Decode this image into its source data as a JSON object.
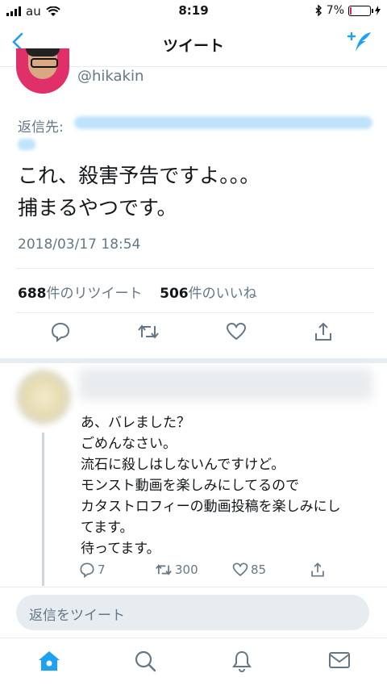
{
  "status_bar": {
    "carrier": "au",
    "time": "8:19",
    "battery": "7%"
  },
  "nav": {
    "title": "ツイート",
    "back_icon": "chevron-left-icon",
    "compose_icon": "compose-icon"
  },
  "tweet": {
    "handle": "@hikakin",
    "reply_prefix": "返信先:",
    "text": "これ、殺害予告ですよ。。。\n捕まるやつです。",
    "timestamp": "2018/03/17 18:54",
    "retweet_count": "688",
    "retweet_label": "件のリツイート",
    "like_count": "506",
    "like_label": "件のいいね"
  },
  "reply": {
    "text": "あ、バレました？\nごめんなさい。\n流石に殺しはしないんですけど。\nモンスト動画を楽しみにしてるので\nカタストロフィーの動画投稿を楽しみにし\nてます。\n待ってます。",
    "reply_count": "7",
    "retweet_count": "300",
    "like_count": "85"
  },
  "reply_box": {
    "placeholder": "返信をツイート"
  },
  "tabbar": {
    "items": [
      "home-icon",
      "search-icon",
      "notifications-icon",
      "messages-icon"
    ]
  },
  "colors": {
    "accent": "#1da1f2",
    "muted": "#657786",
    "divider": "#e6ecf0"
  }
}
